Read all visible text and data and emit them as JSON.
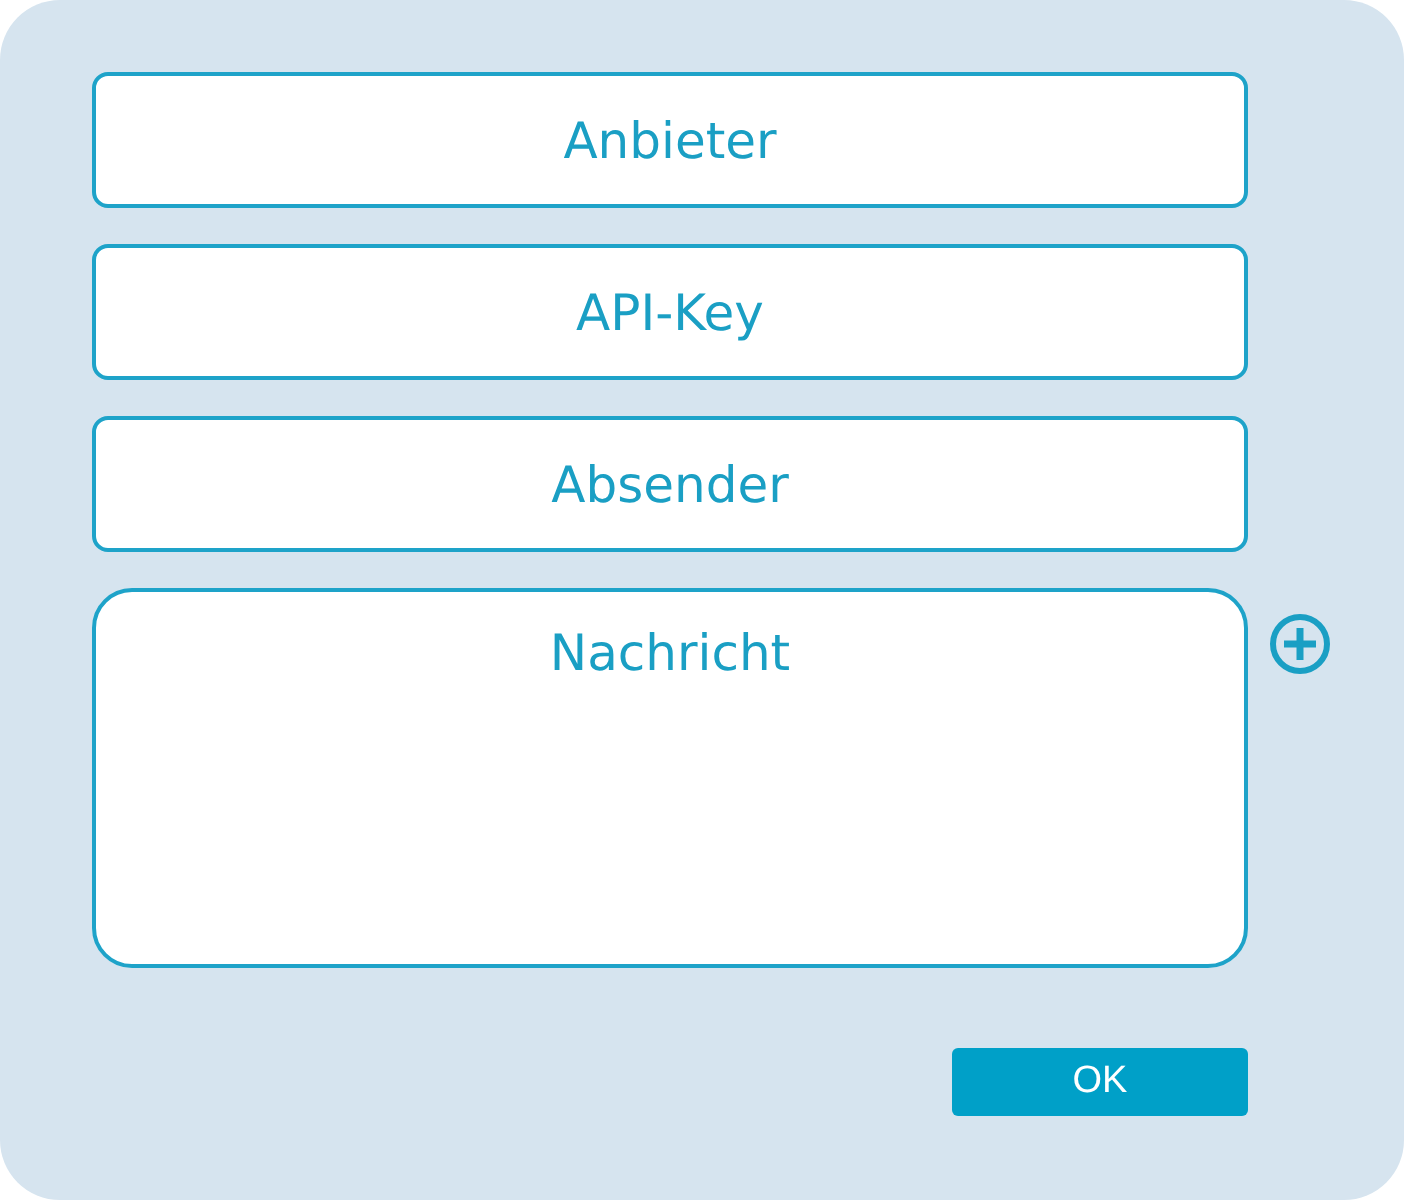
{
  "fields": [
    {
      "kind": "line",
      "placeholder": "Anbieter"
    },
    {
      "kind": "line",
      "placeholder": "API-Key"
    },
    {
      "kind": "line",
      "placeholder": "Absender"
    },
    {
      "kind": "multiline",
      "placeholder": "Nachricht"
    }
  ],
  "ok_button": {
    "label": "OK"
  }
}
